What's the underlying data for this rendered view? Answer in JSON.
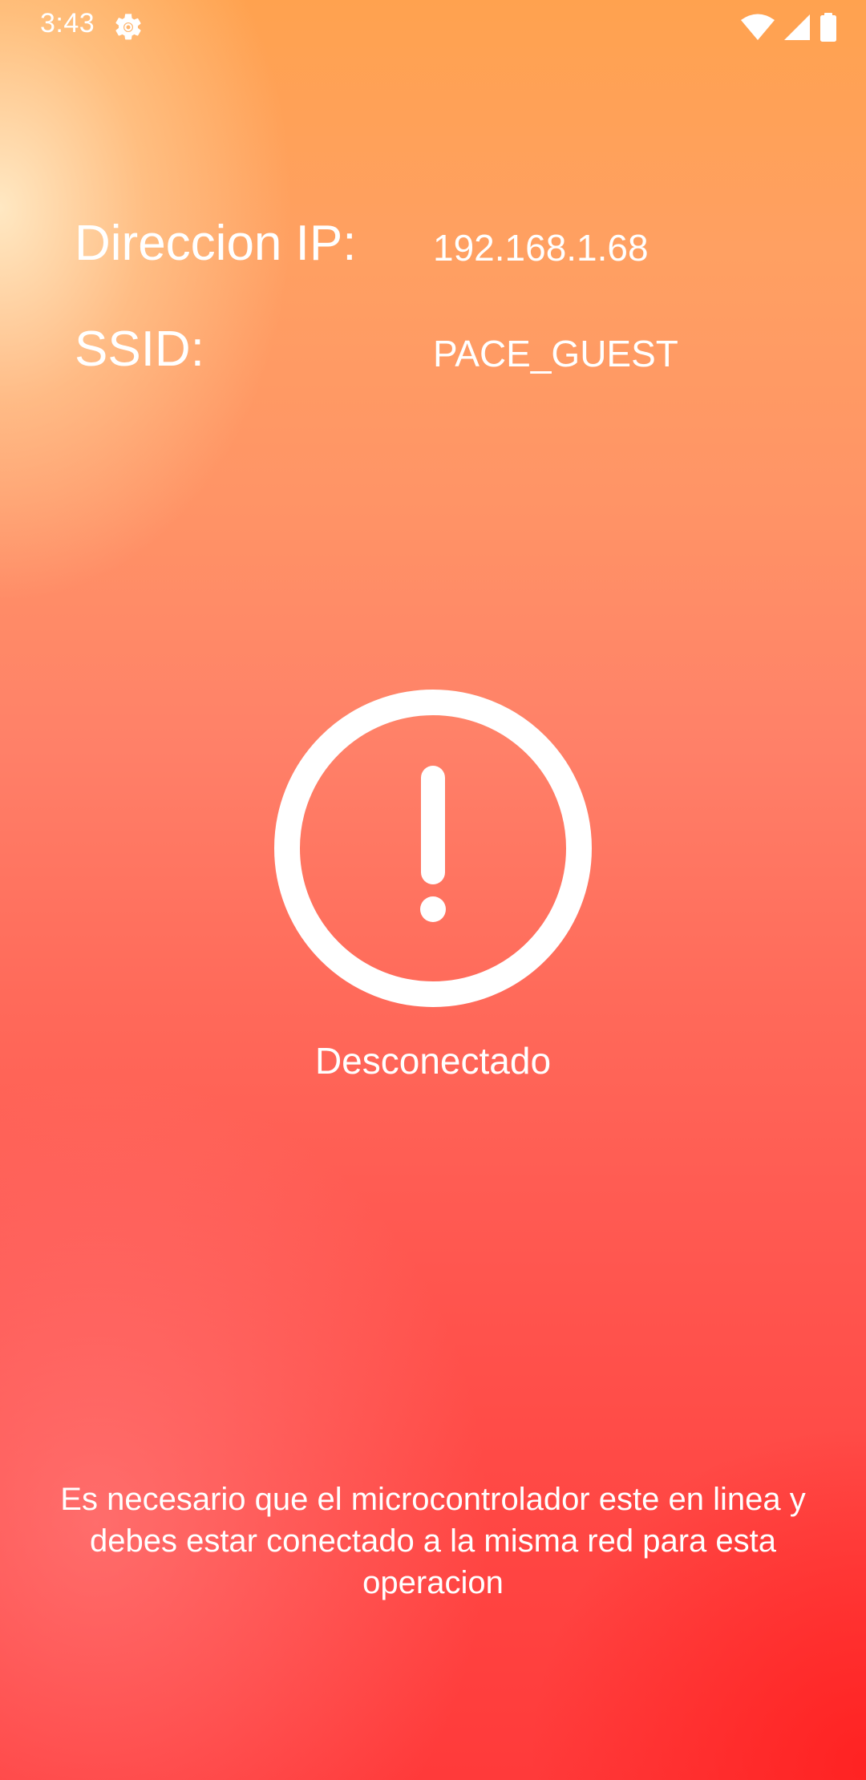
{
  "status_bar": {
    "time": "3:43",
    "icons": [
      "settings-gear-icon",
      "wifi-icon",
      "signal-icon",
      "battery-icon"
    ]
  },
  "network_info": {
    "ip_label": "Direccion IP:",
    "ip_value": "192.168.1.68",
    "ssid_label": "SSID:",
    "ssid_value": "PACE_GUEST"
  },
  "connection": {
    "icon": "alert-circle-icon",
    "status": "Desconectado"
  },
  "help": {
    "message": "Es necesario que el microcontrolador este en linea y debes estar conectado a la misma red para esta operacion"
  },
  "colors": {
    "gradient_top": "#ffa24f",
    "gradient_bottom": "#ff3a3a",
    "text": "#ffffff"
  }
}
